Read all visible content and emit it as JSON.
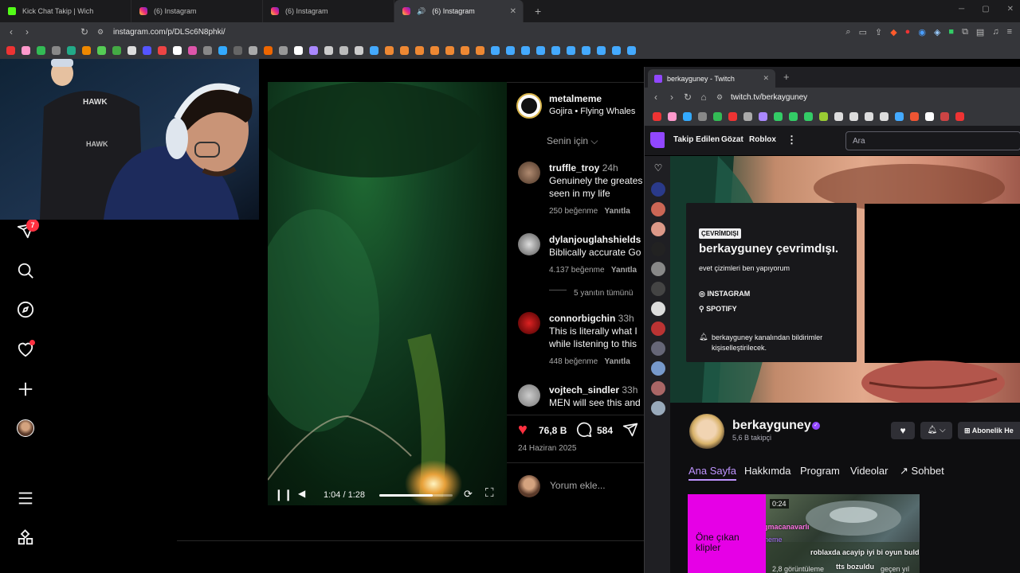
{
  "browser": {
    "tabs": [
      {
        "label": "Kick Chat Takip | Wich",
        "favicon": "kick"
      },
      {
        "label": "(6) Instagram",
        "favicon": "instagram"
      },
      {
        "label": "(6) Instagram",
        "favicon": "instagram"
      },
      {
        "label": "(6) Instagram",
        "favicon": "instagram",
        "active": true
      }
    ],
    "url": "instagram.com/p/DLSc6N8phki/"
  },
  "instagram": {
    "notification_count": "7",
    "post": {
      "username": "metalmeme",
      "audio": "Gojira • Flying Whales",
      "sort_label": "Senin için",
      "time_display": "1:04 / 1:28",
      "progress": 0.73,
      "likes": "76,8 B",
      "comments_count": "584",
      "date": "24 Haziran 2025",
      "comment_placeholder": "Yorum ekle..."
    },
    "comments": [
      {
        "user": "truffle_troy",
        "time": "24h",
        "text1": "Genuinely the greates",
        "text2": "seen in my life",
        "likes": "250 beğenme",
        "reply": "Yanıtla"
      },
      {
        "user": "dylanjouglahshields",
        "time": "",
        "text1": "Biblically accurate Go",
        "text2": "",
        "likes": "4.137 beğenme",
        "reply": "Yanıtla"
      },
      {
        "user": "connorbigchin",
        "time": "33h",
        "text1": "This is literally what I",
        "text2": "while listening to this",
        "likes": "448 beğenme",
        "reply": "Yanıtla"
      },
      {
        "user": "vojtech_sindler",
        "time": "33h",
        "text1": "MEN will see this and",
        "text2": "",
        "likes": "",
        "reply": ""
      }
    ],
    "replies_view": "5 yanıtın tümünü"
  },
  "twitch": {
    "tab_title": "berkayguney - Twitch",
    "url": "twitch.tv/berkayguney",
    "nav": [
      "Takip Edilen",
      "Gözat",
      "Roblox"
    ],
    "search_placeholder": "Ara",
    "offline_badge": "ÇEVRİMDIŞI",
    "offline_title": "berkayguney çevrimdışı.",
    "bio": "evet çizimleri ben yapıyorum",
    "links": [
      "INSTAGRAM",
      "SPOTIFY"
    ],
    "notify_text1": "berkayguney kanalından bildirimler",
    "notify_text2": "kişiselleştirilecek.",
    "channel_name": "berkayguney",
    "followers": "5,6 B takipçi",
    "subscribe_label": "Abonelik He",
    "channel_tabs": [
      "Ana Sayfa",
      "Hakkımda",
      "Program",
      "Videolar",
      "Sohbet"
    ],
    "clips_label": "Öne çıkan klipler",
    "clip_duration": "0:24",
    "clip_chat": [
      "bogmacanavarlı",
      "Mimeme",
      "roblaxda acayip iyi bi oyun buldum",
      "tts bozuldu",
      "2,8 görüntüleme",
      "geçen yıl"
    ]
  },
  "colors": {
    "twitch_purple": "#9147ff",
    "ig_red": "#ff3040",
    "clip_pink": "#e600e6"
  }
}
